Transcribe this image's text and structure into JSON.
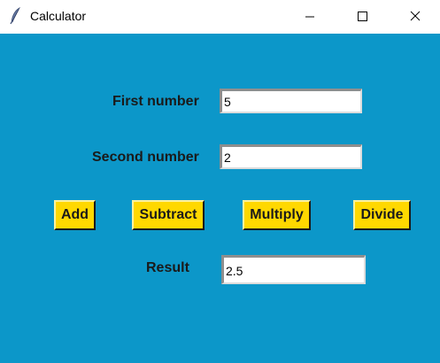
{
  "window": {
    "title": "Calculator",
    "app_icon": "feather-icon",
    "controls": {
      "minimize_icon": "minimize-icon",
      "maximize_icon": "maximize-icon",
      "close_icon": "close-icon"
    }
  },
  "colors": {
    "background": "#0c97c9",
    "button": "#ffd800",
    "titlebar": "#ffffff"
  },
  "form": {
    "first_label": "First number",
    "first_value": "5",
    "second_label": "Second number",
    "second_value": "2",
    "result_label": "Result",
    "result_value": "2.5"
  },
  "buttons": {
    "add": "Add",
    "subtract": "Subtract",
    "multiply": "Multiply",
    "divide": "Divide"
  }
}
